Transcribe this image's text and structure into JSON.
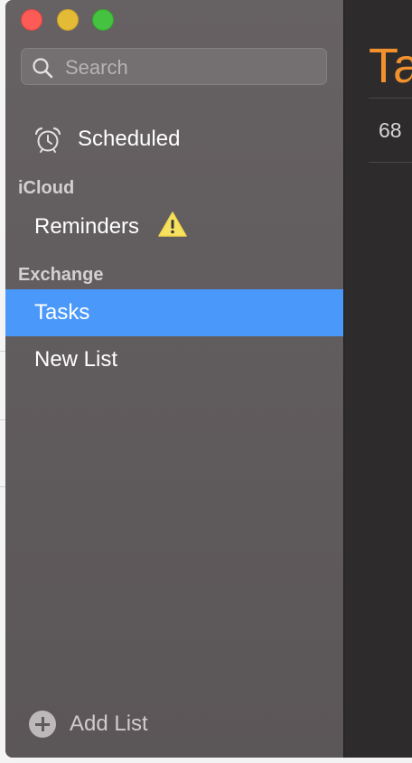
{
  "window": {
    "controls": [
      "close",
      "minimize",
      "zoom"
    ]
  },
  "search": {
    "placeholder": "Search",
    "value": ""
  },
  "sidebar": {
    "smart_lists": [
      {
        "label": "Scheduled",
        "icon": "alarm-clock-icon"
      }
    ],
    "accounts": [
      {
        "name": "iCloud",
        "lists": [
          {
            "label": "Reminders",
            "icon": "warning-icon",
            "warning": true
          }
        ]
      },
      {
        "name": "Exchange",
        "lists": [
          {
            "label": "Tasks",
            "selected": true
          },
          {
            "label": "New List",
            "selected": false
          }
        ]
      }
    ],
    "add_list_label": "Add List",
    "add_list_icon": "plus-circle-icon"
  },
  "main": {
    "title": "Ta",
    "count": "68"
  },
  "colors": {
    "selection": "#4a99fa",
    "title_accent": "#f0912e",
    "warning": "#f7e160"
  }
}
